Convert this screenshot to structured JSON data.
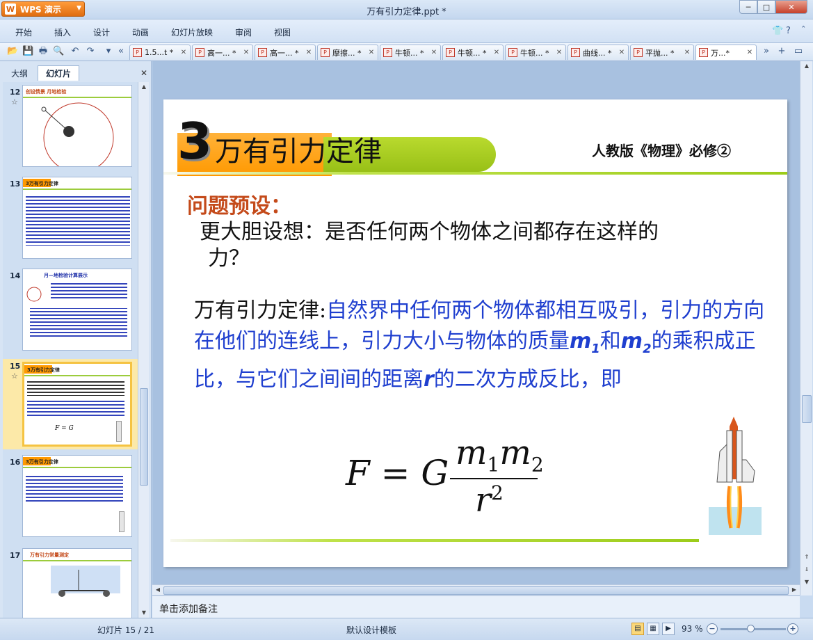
{
  "app": {
    "name": "WPS 演示",
    "window_title": "万有引力定律.ppt *"
  },
  "menu": {
    "items": [
      "开始",
      "插入",
      "设计",
      "动画",
      "幻灯片放映",
      "审阅",
      "视图"
    ]
  },
  "doc_tabs": [
    {
      "label": "1.5...t *"
    },
    {
      "label": "高一... *"
    },
    {
      "label": "高一... *"
    },
    {
      "label": "摩擦... *"
    },
    {
      "label": "牛顿... *"
    },
    {
      "label": "牛顿... *"
    },
    {
      "label": "牛顿... *"
    },
    {
      "label": "曲线... *"
    },
    {
      "label": "平抛... *"
    },
    {
      "label": "万...*"
    }
  ],
  "left_panel": {
    "tab_outline": "大纲",
    "tab_slides": "幻灯片",
    "thumbnails": [
      {
        "number": "12",
        "title": "创设情景 月地检验"
      },
      {
        "number": "13",
        "title": "3万有引力定律"
      },
      {
        "number": "14",
        "title": "月—地检验计算展示"
      },
      {
        "number": "15",
        "title": "3万有引力定律"
      },
      {
        "number": "16",
        "title": "3万有引力定律"
      },
      {
        "number": "17",
        "title": "万有引力常量测定"
      }
    ]
  },
  "slide": {
    "title_number": "3",
    "title_text": "万有引力定律",
    "subtitle": "人教版《物理》必修②",
    "section_heading": "问题预设：",
    "question_line1": "更大胆设想：是否任何两个物体之间都存在这样的",
    "question_line2": "力？",
    "law_label": "万有引力定律:",
    "law_body_part1": "自然界中任何两个物体都相互吸引，引力的方向在他们的连线上，引力大小与物体的质量",
    "law_m1": "m",
    "law_m1_sub": "1",
    "law_and": "和",
    "law_m2": "m",
    "law_m2_sub": "2",
    "law_body_part2": "的乘积成正比，与它们之间间的距离",
    "law_r": "r",
    "law_body_part3": "的二次方成反比，即",
    "formula_lhs": "F = G",
    "formula_numerator_a": "m",
    "formula_numerator_a_sub": "1",
    "formula_numerator_b": "m",
    "formula_numerator_b_sub": "2",
    "formula_denominator": "r",
    "formula_denominator_sup": "2"
  },
  "notes": {
    "placeholder": "单击添加备注"
  },
  "status": {
    "slide_position": "幻灯片 15 / 21",
    "template": "默认设计模板",
    "zoom": "93 %"
  },
  "colors": {
    "accent_orange": "#ff9900",
    "accent_green": "#9ccc1a",
    "law_text_blue": "#1f3fcf",
    "section_red": "#c44a1a"
  }
}
